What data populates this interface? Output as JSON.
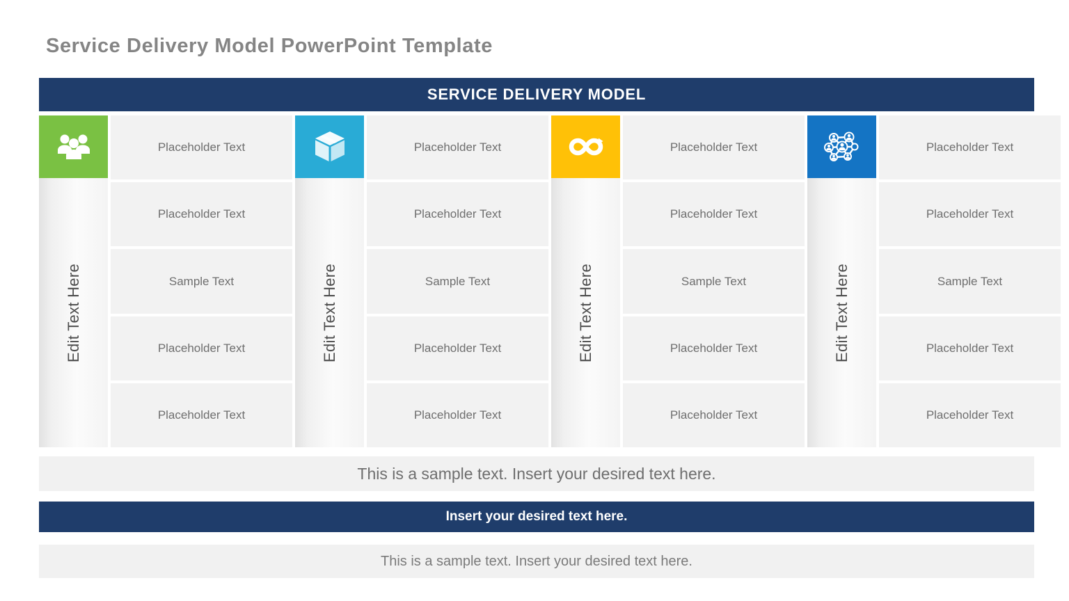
{
  "page": {
    "title": "Service Delivery Model PowerPoint Template"
  },
  "banner": {
    "title": "SERVICE DELIVERY MODEL"
  },
  "colors": {
    "navy": "#1f3d6b",
    "green": "#7ac143",
    "cyan": "#29abd6",
    "amber": "#ffc107",
    "blue": "#1474c4",
    "cell_bg": "#f2f2f2",
    "title_gray": "#858585"
  },
  "columns": [
    {
      "icon": "people-group-icon",
      "accent": "#7ac143",
      "vertical_label": "Edit Text Here",
      "cells": [
        "Placeholder Text",
        "Placeholder Text",
        "Sample Text",
        "Placeholder Text",
        "Placeholder Text"
      ]
    },
    {
      "icon": "package-box-icon",
      "accent": "#29abd6",
      "vertical_label": "Edit Text Here",
      "cells": [
        "Placeholder Text",
        "Placeholder Text",
        "Sample Text",
        "Placeholder Text",
        "Placeholder Text"
      ]
    },
    {
      "icon": "infinity-loop-icon",
      "accent": "#ffc107",
      "vertical_label": "Edit Text Here",
      "cells": [
        "Placeholder Text",
        "Placeholder Text",
        "Sample Text",
        "Placeholder Text",
        "Placeholder Text"
      ]
    },
    {
      "icon": "network-people-icon",
      "accent": "#1474c4",
      "vertical_label": "Edit Text Here",
      "cells": [
        "Placeholder Text",
        "Placeholder Text",
        "Sample Text",
        "Placeholder Text",
        "Placeholder Text"
      ]
    }
  ],
  "footer": {
    "bar_top": "This is a sample text. Insert your desired text here.",
    "bar_middle": "Insert your desired text here.",
    "bar_bottom": "This is a sample text. Insert your desired text here."
  }
}
